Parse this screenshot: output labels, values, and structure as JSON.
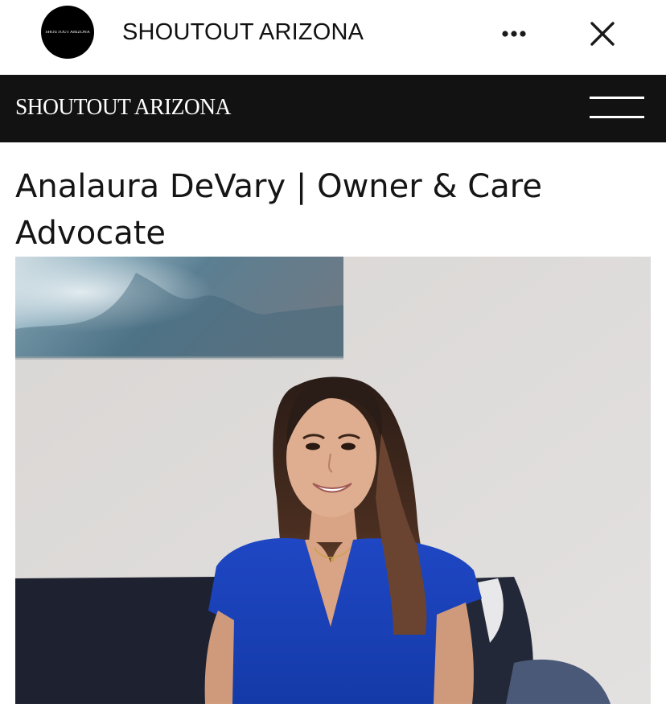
{
  "browser_bar": {
    "avatar_text": "SHOUTOUT ARIZONA",
    "title": "SHOUTOUT ARIZONA",
    "more_icon": "more-horizontal-icon",
    "close_icon": "close-icon"
  },
  "site_header": {
    "logo_text": "SHOUTOUT ARIZONA",
    "menu_icon": "hamburger-menu-icon",
    "background": "#121212"
  },
  "article": {
    "title": "Analaura DeVary | Owner & Care Advocate"
  },
  "hero_image": {
    "subject": "portrait-photo"
  }
}
